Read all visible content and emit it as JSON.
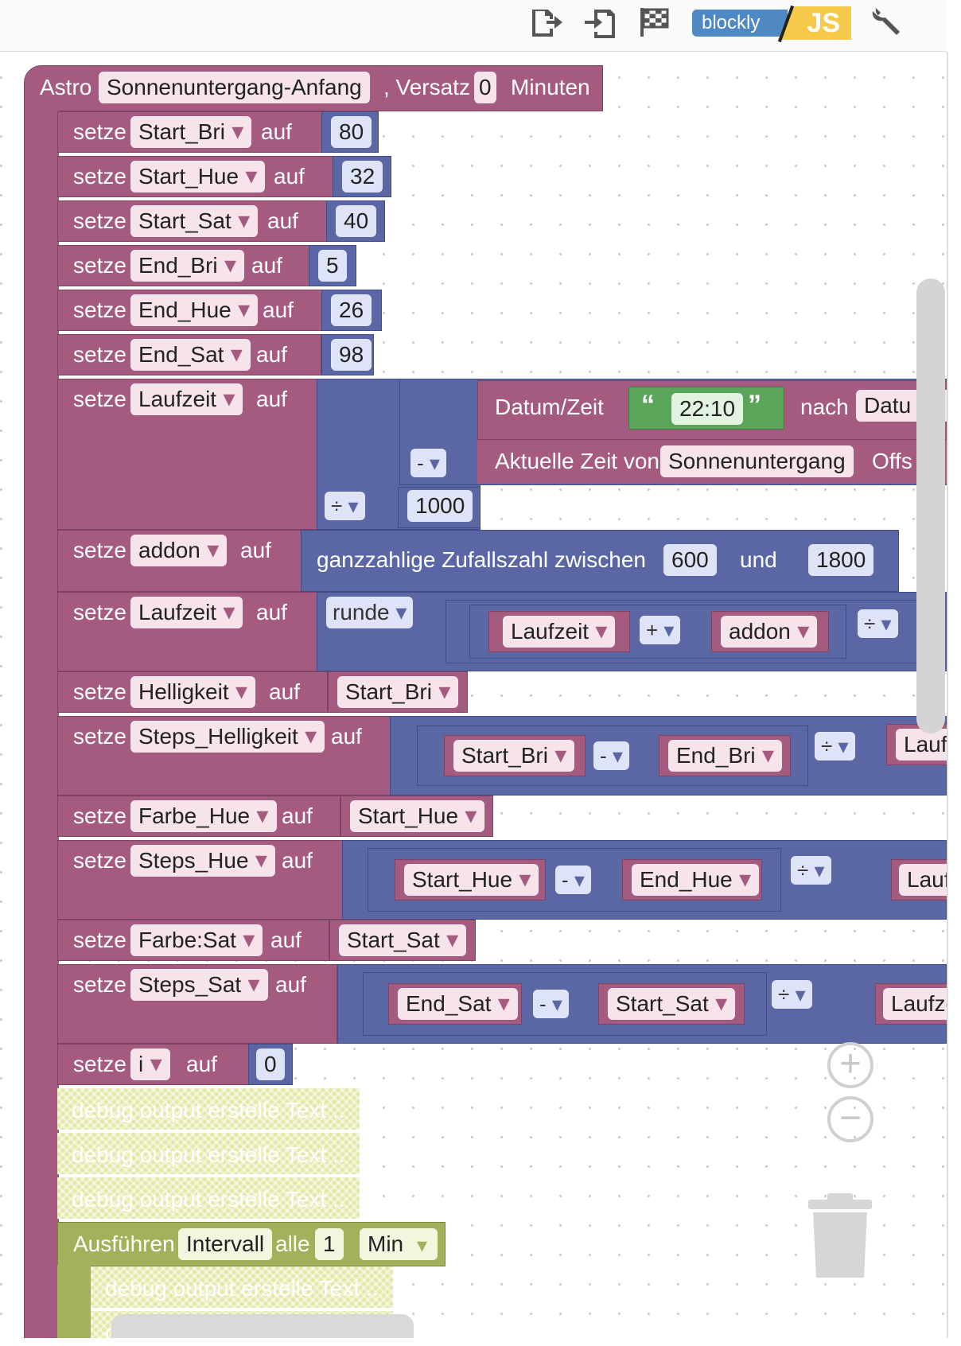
{
  "toolbar": {
    "icons": [
      "export-icon",
      "import-icon",
      "flag-icon",
      "wrench-icon"
    ],
    "logo_left": "blockly",
    "logo_right": "JS"
  },
  "astro": {
    "label": "Astro",
    "event": "Sonnenuntergang-Anfang",
    "offset_label": ", Versatz",
    "offset_value": "0",
    "unit": "Minuten"
  },
  "setze": "setze",
  "auf": "auf",
  "sets": [
    {
      "var": "Start_Bri",
      "value": "80"
    },
    {
      "var": "Start_Hue",
      "value": "32"
    },
    {
      "var": "Start_Sat",
      "value": "40"
    },
    {
      "var": "End_Bri",
      "value": "5"
    },
    {
      "var": "End_Hue",
      "value": "26"
    },
    {
      "var": "End_Sat",
      "value": "98"
    }
  ],
  "laufzeit1": {
    "var": "Laufzeit",
    "datum_label": "Datum/Zeit",
    "time_value": "22:10",
    "quote_open": "“",
    "quote_close": "”",
    "nach": "nach",
    "nach_target": "Datu",
    "minus_op": "-",
    "aktuelle": "Aktuelle Zeit von",
    "astro_value": "Sonnenuntergang",
    "offs": "Offs",
    "div_op": "÷",
    "divisor": "1000"
  },
  "addon": {
    "var": "addon",
    "text": "ganzzahlige Zufallszahl zwischen",
    "from": "600",
    "und": "und",
    "to": "1800"
  },
  "laufzeit2": {
    "var": "Laufzeit",
    "runde": "runde",
    "a": "Laufzeit",
    "plus_op": "+",
    "b": "addon",
    "div_op": "÷"
  },
  "helligkeit": {
    "var": "Helligkeit",
    "value": "Start_Bri"
  },
  "steps_helligkeit": {
    "var": "Steps_Helligkeit",
    "a": "Start_Bri",
    "op": "-",
    "b": "End_Bri",
    "div": "÷",
    "c": "Lauf"
  },
  "farbe_hue": {
    "var": "Farbe_Hue",
    "value": "Start_Hue"
  },
  "steps_hue": {
    "var": "Steps_Hue",
    "a": "Start_Hue",
    "op": "-",
    "b": "End_Hue",
    "div": "÷",
    "c": "Lauf"
  },
  "farbe_sat": {
    "var": "Farbe:Sat",
    "value": "Start_Sat"
  },
  "steps_sat": {
    "var": "Steps_Sat",
    "a": "End_Sat",
    "op": "-",
    "b": "Start_Sat",
    "div": "÷",
    "c": "Laufze"
  },
  "set_i": {
    "var": "i",
    "value": "0"
  },
  "debug_text": "debug output erstelle Text ..",
  "interval": {
    "label": "Ausführen",
    "mode": "Intervall",
    "alle": "alle",
    "value": "1",
    "unit": "Min"
  },
  "inner_debug": "debug output erstelle Text ..",
  "cut_debug": "de"
}
